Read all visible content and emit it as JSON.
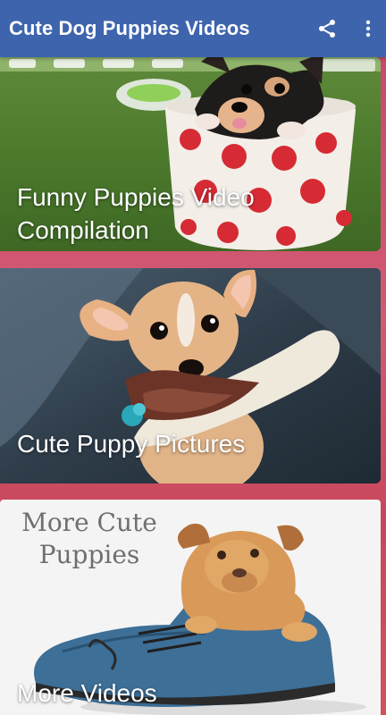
{
  "app": {
    "title": "Cute Dog Puppies Videos",
    "share_icon": "share-icon",
    "overflow_icon": "more-vert-icon",
    "bar_color": "#3e64ad"
  },
  "cards": [
    {
      "label_line1": "Funny Puppies Video",
      "label_line2": "Compilation"
    },
    {
      "label": "Cute Puppy Pictures"
    },
    {
      "label": "More Videos",
      "overlay_line1": "More Cute",
      "overlay_line2": "Puppies"
    }
  ],
  "colors": {
    "background": "#c7485d",
    "label_text": "#ffffff"
  }
}
